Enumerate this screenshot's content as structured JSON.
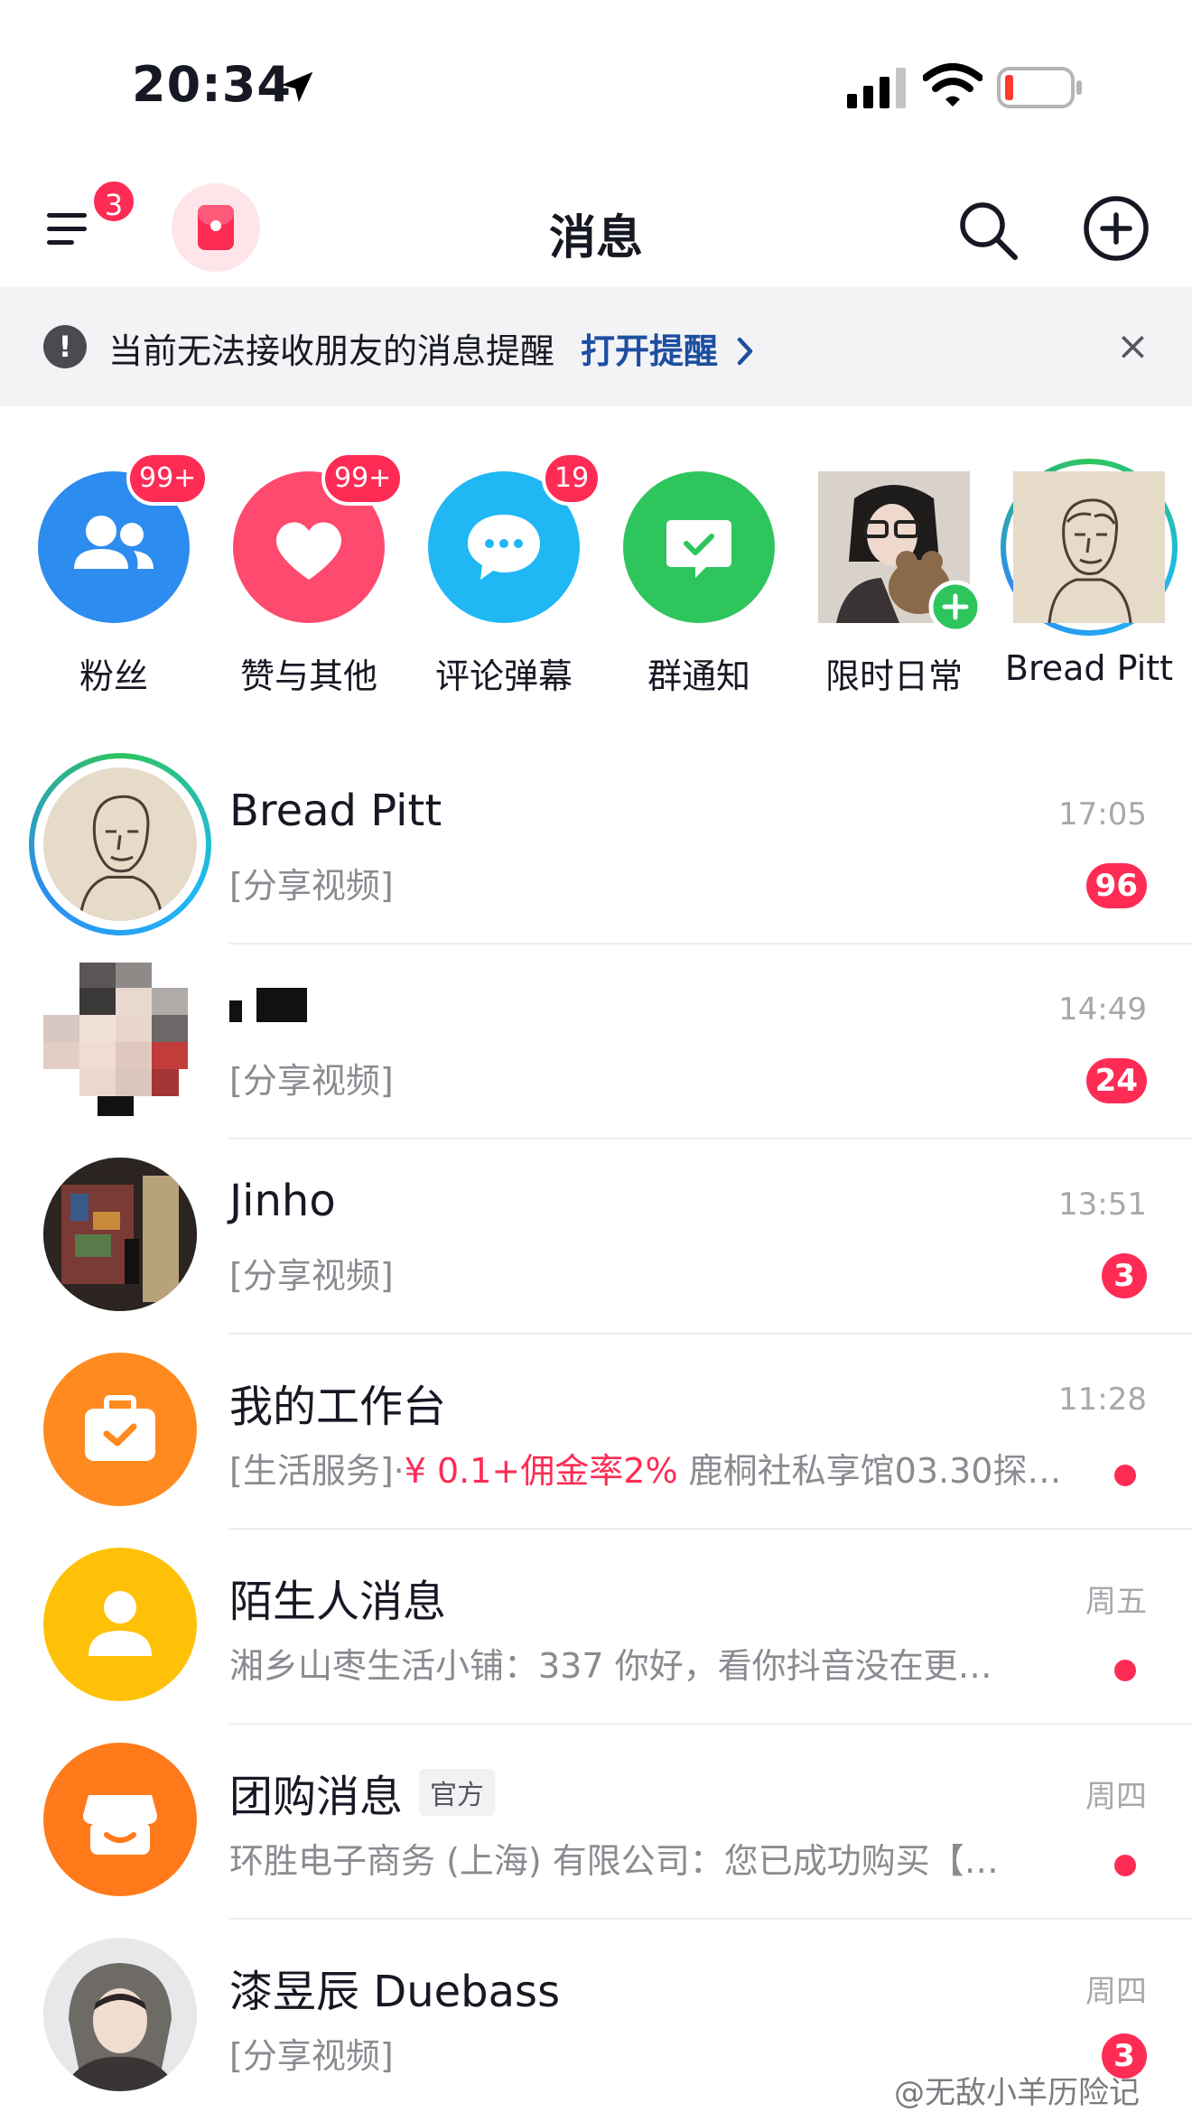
{
  "status_bar": {
    "time": "20:34"
  },
  "header": {
    "title": "消息",
    "menu_badge": "3"
  },
  "notice": {
    "text": "当前无法接收朋友的消息提醒",
    "link": "打开提醒",
    "close": "×"
  },
  "shortcuts": [
    {
      "label": "粉丝",
      "badge": "99+",
      "icon": "fans-icon",
      "color": "#2d8cf0"
    },
    {
      "label": "赞与其他",
      "badge": "99+",
      "icon": "heart-icon",
      "color": "#fe4a6e"
    },
    {
      "label": "评论弹幕",
      "badge": "19",
      "icon": "comment-icon",
      "color": "#1fb8f5"
    },
    {
      "label": "群通知",
      "badge": "",
      "icon": "group-notice-icon",
      "color": "#2ec55d"
    },
    {
      "label": "限时日常",
      "badge": "",
      "icon": "add-story-icon"
    },
    {
      "label": "Bread Pitt",
      "badge": ""
    }
  ],
  "conversations": [
    {
      "name": "Bread Pitt",
      "preview": "[分享视频]",
      "time": "17:05",
      "count": "96"
    },
    {
      "name": "",
      "preview": "[分享视频]",
      "time": "14:49",
      "count": "24"
    },
    {
      "name": "Jinho",
      "preview": "[分享视频]",
      "time": "13:51",
      "count": "3"
    },
    {
      "name": "我的工作台",
      "preview_prefix": "[生活服务]·",
      "preview_highlight": "¥ 0.1+佣金率2%",
      "preview_suffix": " 鹿桐社私享馆03.30探…",
      "time": "11:28",
      "icon": "briefcase-icon",
      "color": "#ff8a1f"
    },
    {
      "name": "陌生人消息",
      "preview": "湘乡山枣生活小铺：337 你好，看你抖音没在更…",
      "time": "周五",
      "icon": "person-icon",
      "color": "#ffc107"
    },
    {
      "name": "团购消息",
      "tag": "官方",
      "preview": "环胜电子商务 (上海) 有限公司：您已成功购买【…",
      "time": "周四",
      "icon": "shop-icon",
      "color": "#ff7a1a"
    },
    {
      "name": "漆昱辰 Duebass",
      "preview": "[分享视频]",
      "time": "周四",
      "count": "3"
    }
  ],
  "watermark": "@无敌小羊历险记"
}
